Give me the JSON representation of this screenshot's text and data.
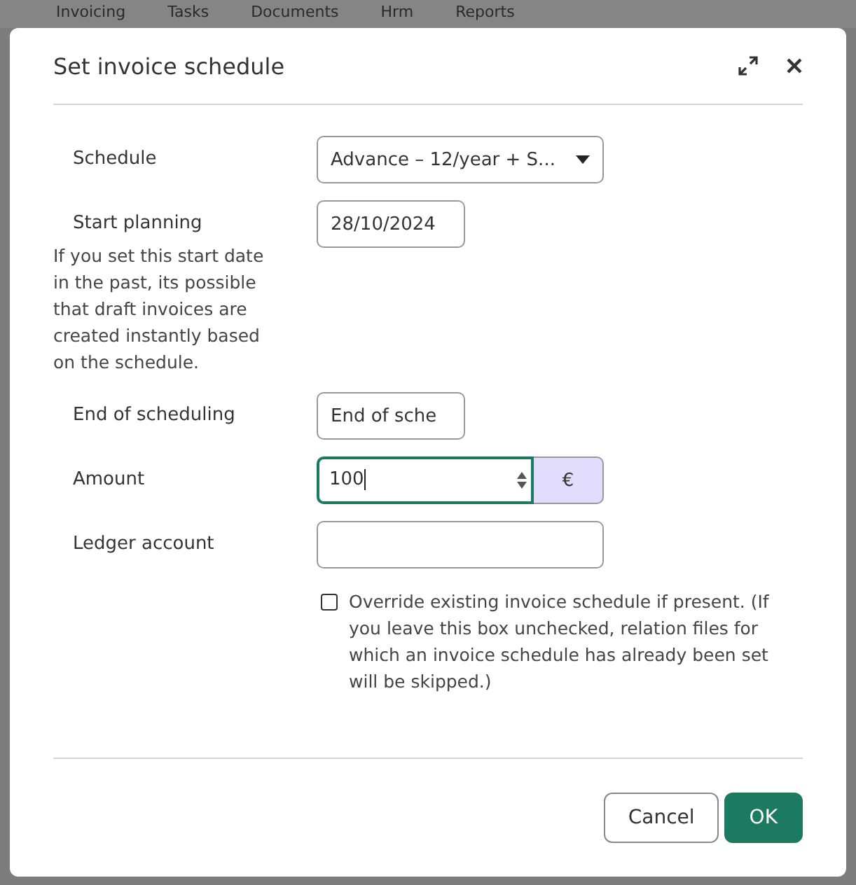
{
  "background_nav": {
    "tabs": [
      {
        "label": "Invoicing"
      },
      {
        "label": "Tasks"
      },
      {
        "label": "Documents"
      },
      {
        "label": "Hrm"
      },
      {
        "label": "Reports"
      }
    ]
  },
  "dialog": {
    "title": "Set invoice schedule",
    "fields": [
      {
        "label": "Schedule",
        "kind": "select",
        "value": "Advance – 12/year + S..."
      },
      {
        "label": "Start planning",
        "kind": "date",
        "value": "28/10/2024",
        "help": "If you set this start date in the past, its possible that draft invoices are created instantly based on the schedule."
      },
      {
        "label": "End of scheduling",
        "kind": "short",
        "placeholder": "End of sche"
      },
      {
        "label": "Amount",
        "kind": "number",
        "value": "100",
        "suffix": "€",
        "focused": true
      },
      {
        "label": "Ledger account",
        "kind": "text"
      }
    ],
    "checkbox": {
      "label": "Override existing invoice schedule if present. (If you leave this box unchecked, relation files for which an invoice schedule has already been set will be skipped.)",
      "checked": false
    },
    "buttons": [
      {
        "label": "Cancel",
        "kind": "secondary"
      },
      {
        "label": "OK",
        "kind": "primary"
      }
    ]
  }
}
